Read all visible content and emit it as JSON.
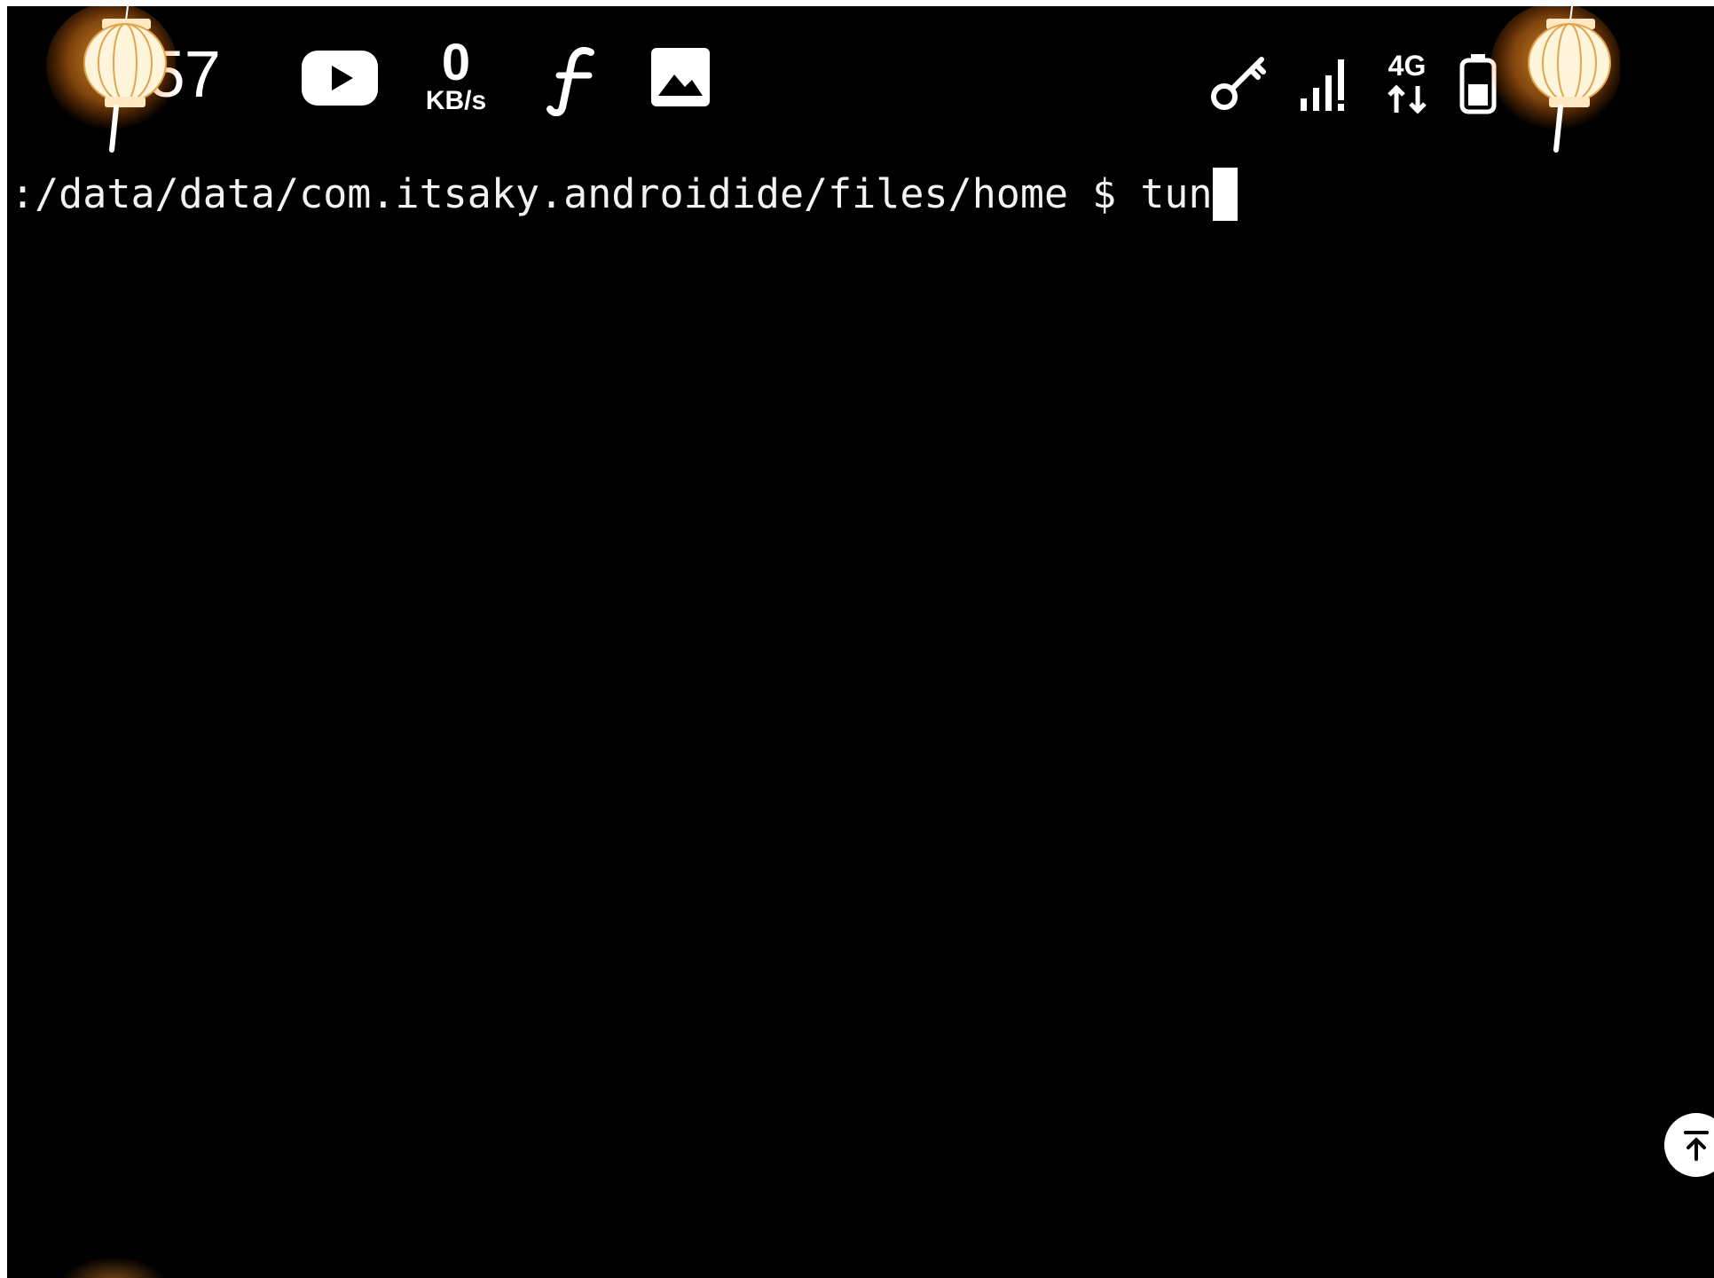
{
  "status_bar": {
    "time": ".57",
    "net_speed_value": "0",
    "net_speed_unit": "KB/s",
    "battery_percent": "",
    "network_type": "4G",
    "icons": [
      "youtube-icon",
      "facebook-lite-icon",
      "gallery-icon",
      "vpn-key-icon",
      "signal-icon",
      "4g-data-icon",
      "battery-icon"
    ]
  },
  "terminal": {
    "prompt_path": ":/data/data/com.itsaky.androidide/files/home $ ",
    "command": "tun"
  },
  "scroll_top_button": {
    "icon": "arrow-to-top-icon"
  },
  "decorations": [
    "lantern-left",
    "lantern-right"
  ],
  "colors": {
    "background": "#000000",
    "text": "#f2f2f2",
    "lantern": "#ffe0a6",
    "glow": "#ff9a2a"
  }
}
